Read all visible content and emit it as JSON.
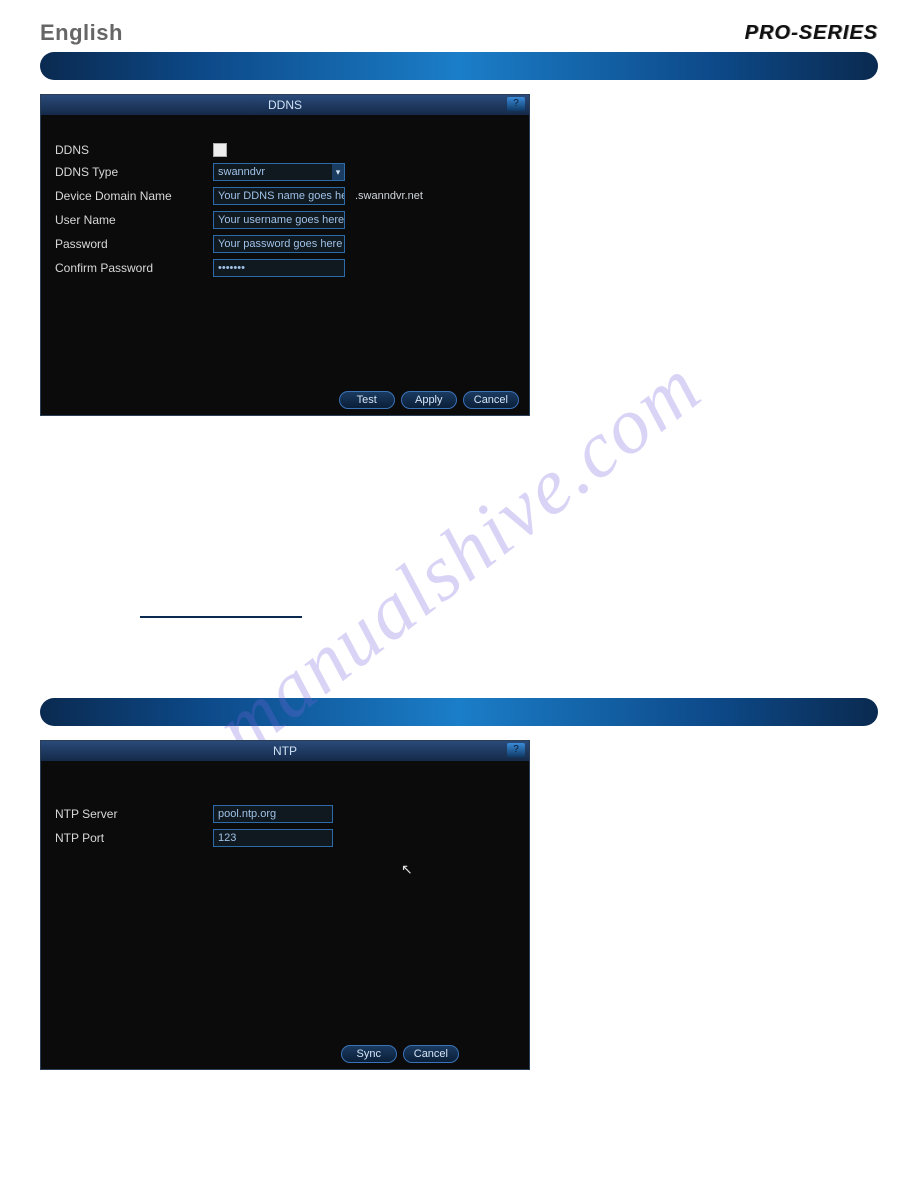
{
  "header": {
    "language": "English",
    "brand": "PRO-SERIES"
  },
  "watermark": "manualshive.com",
  "dialogs": {
    "ddns": {
      "title": "DDNS",
      "help_glyph": "?",
      "rows": {
        "enable_label": "DDNS",
        "type_label": "DDNS Type",
        "type_value": "swanndvr",
        "domain_label": "Device Domain Name",
        "domain_value": "Your DDNS name goes here",
        "domain_suffix": ".swanndvr.net",
        "user_label": "User Name",
        "user_value": "Your username goes here",
        "pass_label": "Password",
        "pass_value": "Your password goes here",
        "confirm_label": "Confirm Password",
        "confirm_value": "•••••••"
      },
      "buttons": {
        "test": "Test",
        "apply": "Apply",
        "cancel": "Cancel"
      }
    },
    "ntp": {
      "title": "NTP",
      "help_glyph": "?",
      "rows": {
        "server_label": "NTP Server",
        "server_value": "pool.ntp.org",
        "port_label": "NTP Port",
        "port_value": "123"
      },
      "buttons": {
        "sync": "Sync",
        "cancel": "Cancel"
      }
    }
  }
}
